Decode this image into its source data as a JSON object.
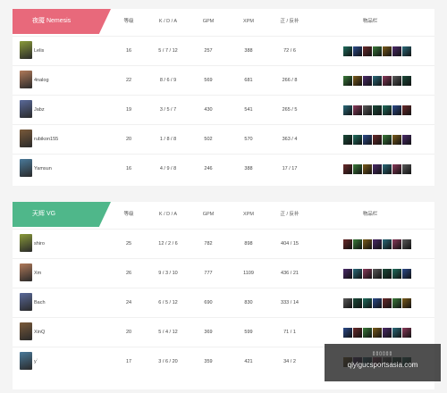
{
  "headers": {
    "level": "等级",
    "kda": "K / D / A",
    "gpm": "GPM",
    "xpm": "XPM",
    "lh_dn": "正 / 反补",
    "items": "物品栏"
  },
  "teams": [
    {
      "name": "夜魇 Nemesis",
      "color": "#e8697b",
      "players": [
        {
          "name": "Lelis",
          "level": "16",
          "kda": "5 / 7 / 12",
          "gpm": "257",
          "xpm": "388",
          "lh_dn": "72 / 6"
        },
        {
          "name": "4nalog",
          "level": "22",
          "kda": "8 / 6 / 9",
          "gpm": "569",
          "xpm": "681",
          "lh_dn": "266 / 8"
        },
        {
          "name": "Jabz",
          "level": "19",
          "kda": "3 / 5 / 7",
          "gpm": "430",
          "xpm": "541",
          "lh_dn": "265 / 5"
        },
        {
          "name": "rubikon155",
          "level": "20",
          "kda": "1 / 8 / 8",
          "gpm": "502",
          "xpm": "570",
          "lh_dn": "363 / 4"
        },
        {
          "name": "Yamsun",
          "level": "16",
          "kda": "4 / 9 / 8",
          "gpm": "246",
          "xpm": "388",
          "lh_dn": "17 / 17"
        }
      ]
    },
    {
      "name": "天辉 VG",
      "color": "#4fb78a",
      "players": [
        {
          "name": "shiro",
          "level": "25",
          "kda": "12 / 2 / 6",
          "gpm": "782",
          "xpm": "898",
          "lh_dn": "404 / 15"
        },
        {
          "name": "Xm",
          "level": "26",
          "kda": "9 / 3 / 10",
          "gpm": "777",
          "xpm": "1109",
          "lh_dn": "436 / 21"
        },
        {
          "name": "Bach",
          "level": "24",
          "kda": "6 / 5 / 12",
          "gpm": "690",
          "xpm": "830",
          "lh_dn": "333 / 14"
        },
        {
          "name": "XinQ",
          "level": "20",
          "kda": "5 / 4 / 12",
          "gpm": "369",
          "xpm": "599",
          "lh_dn": "71 / 1"
        },
        {
          "name": "y`",
          "level": "17",
          "kda": "3 / 6 / 20",
          "gpm": "359",
          "xpm": "421",
          "lh_dn": "34 / 2"
        }
      ]
    }
  ],
  "watermark": {
    "top": "▯▯▯▯▯▯",
    "url": "qiyigucsportsasia.com"
  }
}
